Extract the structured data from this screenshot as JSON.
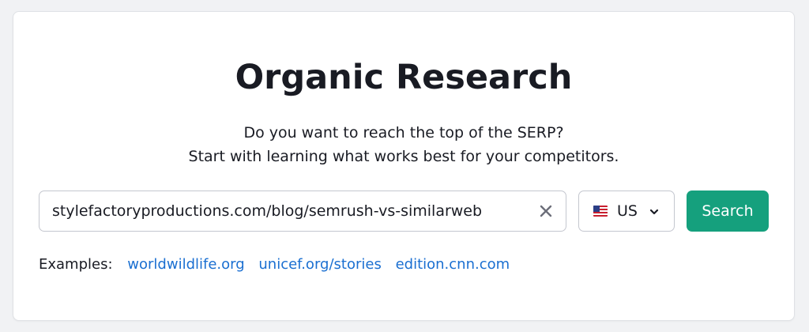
{
  "title": "Organic Research",
  "subtitle": {
    "line1": "Do you want to reach the top of the SERP?",
    "line2": "Start with learning what works best for your competitors."
  },
  "search": {
    "value": "stylefactoryproductions.com/blog/semrush-vs-similarweb",
    "clear_icon": "close-icon",
    "country": {
      "flag_icon": "us-flag-icon",
      "selected": "US",
      "chevron_icon": "chevron-down-icon"
    },
    "button_label": "Search"
  },
  "examples": {
    "label": "Examples:",
    "links": [
      "worldwildlife.org",
      "unicef.org/stories",
      "edition.cnn.com"
    ]
  },
  "colors": {
    "accent": "#15a07d",
    "link": "#1a6fd1",
    "text": "#191b23",
    "background": "#f1f2f4"
  }
}
